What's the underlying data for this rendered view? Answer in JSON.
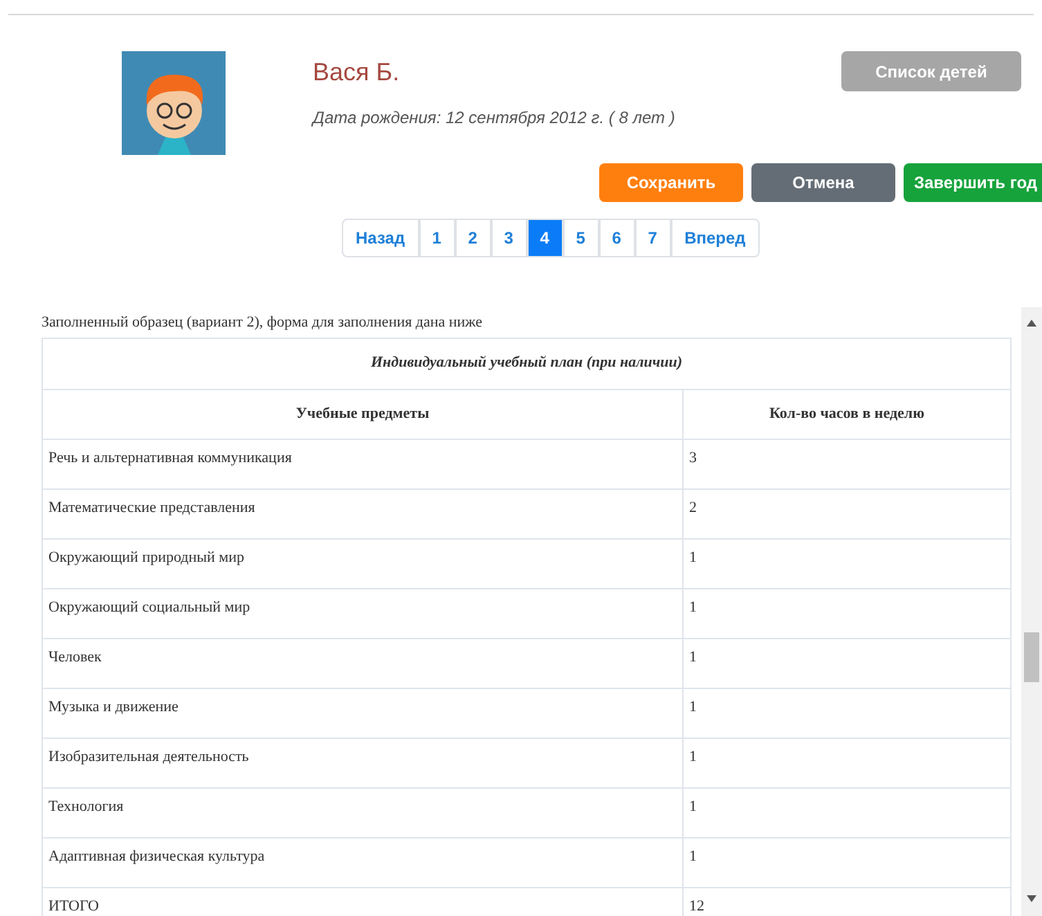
{
  "profile": {
    "name": "Вася Б.",
    "birth": "Дата рождения: 12 сентября 2012 г. ( 8 лет )",
    "children_button": "Список детей"
  },
  "actions": [
    {
      "label": "Сохранить",
      "kind": "save"
    },
    {
      "label": "Отмена",
      "kind": "cancel"
    },
    {
      "label": "Завершить год",
      "kind": "finish"
    }
  ],
  "pagination": {
    "prev": "Назад",
    "next": "Вперед",
    "pages": [
      {
        "label": "1",
        "selected": false
      },
      {
        "label": "2",
        "selected": false
      },
      {
        "label": "3",
        "selected": false
      },
      {
        "label": "4",
        "selected": true
      },
      {
        "label": "5",
        "selected": false
      },
      {
        "label": "6",
        "selected": false
      },
      {
        "label": "7",
        "selected": false
      }
    ]
  },
  "document": {
    "note": "Заполненный образец (вариант 2), форма для заполнения дана ниже",
    "table": {
      "title": "Индивидуальный учебный план (при наличии)",
      "columns": [
        "Учебные предметы",
        "Кол-во часов в неделю"
      ],
      "rows": [
        [
          "Речь и альтернативная коммуникация",
          "3"
        ],
        [
          "Математические представления",
          "2"
        ],
        [
          "Окружающий природный мир",
          "1"
        ],
        [
          "Окружающий социальный мир",
          "1"
        ],
        [
          "Человек",
          "1"
        ],
        [
          "Музыка и движение",
          "1"
        ],
        [
          "Изобразительная деятельность",
          "1"
        ],
        [
          "Технология",
          "1"
        ],
        [
          "Адаптивная физическая культура",
          "1"
        ],
        [
          "ИТОГО",
          "12"
        ]
      ]
    }
  }
}
